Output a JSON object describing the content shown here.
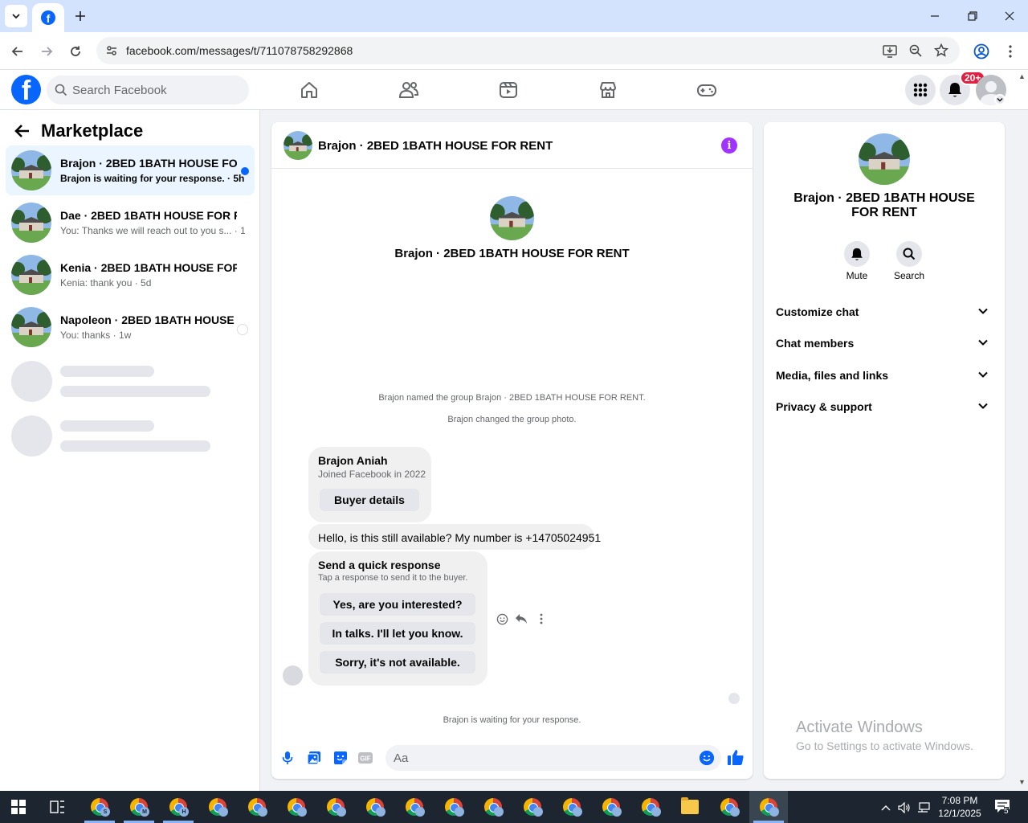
{
  "browser": {
    "url": "facebook.com/messages/t/711078758292868"
  },
  "fb": {
    "search_placeholder": "Search Facebook",
    "notification_badge": "20+"
  },
  "left": {
    "title": "Marketplace",
    "conversations": [
      {
        "title": "Brajon · 2BED 1BATH HOUSE FO...",
        "subtitle": "Brajon is waiting for your response. · 5h"
      },
      {
        "title": "Dae · 2BED 1BATH HOUSE FOR RE...",
        "subtitle": "You: Thanks we will reach out to you s... · 1d"
      },
      {
        "title": "Kenia · 2BED 1BATH HOUSE FOR R...",
        "subtitle": "Kenia: thank you · 5d"
      },
      {
        "title": "Napoleon · 2BED 1BATH HOUSE ...",
        "subtitle": "You: thanks · 1w"
      }
    ]
  },
  "chat": {
    "header_title": "Brajon · 2BED 1BATH HOUSE FOR RENT",
    "intro_title": "Brajon · 2BED 1BATH HOUSE FOR RENT",
    "system_messages": [
      "Brajon named the group Brajon · 2BED 1BATH HOUSE FOR RENT.",
      "Brajon changed the group photo."
    ],
    "buyer_card": {
      "name": "Brajon Aniah",
      "joined": "Joined Facebook in 2022",
      "button": "Buyer details"
    },
    "message": "Hello, is this still available? My number is +14705024951",
    "quick_response": {
      "title": "Send a quick response",
      "subtitle": "Tap a response to send it to the buyer.",
      "options": [
        "Yes, are you interested?",
        "In talks. I'll let you know.",
        "Sorry, it's not available."
      ]
    },
    "waiting_status": "Brajon is waiting for your response.",
    "composer_placeholder": "Aa",
    "gif_label": "GIF"
  },
  "right": {
    "name": "Brajon · 2BED 1BATH HOUSE FOR RENT",
    "actions": {
      "mute": "Mute",
      "search": "Search"
    },
    "sections": [
      "Customize chat",
      "Chat members",
      "Media, files and links",
      "Privacy & support"
    ]
  },
  "watermark": {
    "line1": "Activate Windows",
    "line2": "Go to Settings to activate Windows."
  },
  "taskbar": {
    "time": "7:08 PM",
    "date": "12/1/2025",
    "notification_count": "5",
    "app_labels": [
      "S",
      "M",
      "H"
    ]
  },
  "colors": {
    "fb_blue": "#0866ff",
    "unread_blue": "#0866ff",
    "info_purple": "#a033ff",
    "badge_red": "#e41e3f"
  }
}
